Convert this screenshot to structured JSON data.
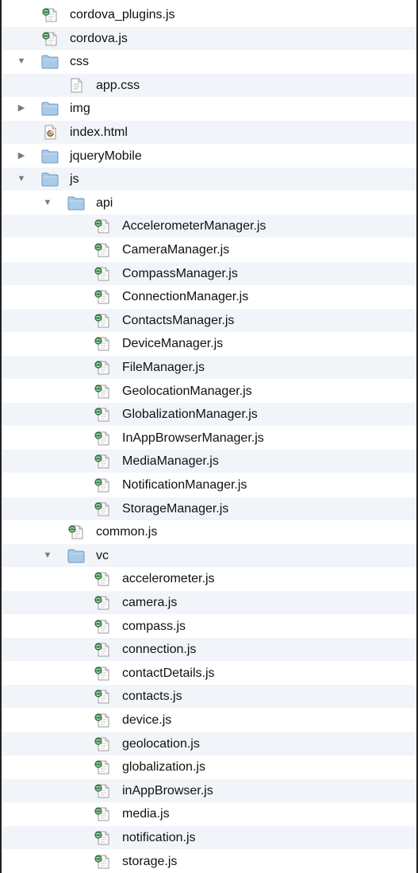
{
  "items": [
    {
      "name": "cordova_plugins.js",
      "type": "js",
      "depth": 0
    },
    {
      "name": "cordova.js",
      "type": "js",
      "depth": 0
    },
    {
      "name": "css",
      "type": "folder",
      "depth": 0,
      "expanded": true
    },
    {
      "name": "app.css",
      "type": "css",
      "depth": 1
    },
    {
      "name": "img",
      "type": "folder",
      "depth": 0,
      "expanded": false
    },
    {
      "name": "index.html",
      "type": "html",
      "depth": 0
    },
    {
      "name": "jqueryMobile",
      "type": "folder",
      "depth": 0,
      "expanded": false
    },
    {
      "name": "js",
      "type": "folder",
      "depth": 0,
      "expanded": true
    },
    {
      "name": "api",
      "type": "folder",
      "depth": 1,
      "expanded": true
    },
    {
      "name": "AccelerometerManager.js",
      "type": "js",
      "depth": 2
    },
    {
      "name": "CameraManager.js",
      "type": "js",
      "depth": 2
    },
    {
      "name": "CompassManager.js",
      "type": "js",
      "depth": 2
    },
    {
      "name": "ConnectionManager.js",
      "type": "js",
      "depth": 2
    },
    {
      "name": "ContactsManager.js",
      "type": "js",
      "depth": 2
    },
    {
      "name": "DeviceManager.js",
      "type": "js",
      "depth": 2
    },
    {
      "name": "FileManager.js",
      "type": "js",
      "depth": 2
    },
    {
      "name": "GeolocationManager.js",
      "type": "js",
      "depth": 2
    },
    {
      "name": "GlobalizationManager.js",
      "type": "js",
      "depth": 2
    },
    {
      "name": "InAppBrowserManager.js",
      "type": "js",
      "depth": 2
    },
    {
      "name": "MediaManager.js",
      "type": "js",
      "depth": 2
    },
    {
      "name": "NotificationManager.js",
      "type": "js",
      "depth": 2
    },
    {
      "name": "StorageManager.js",
      "type": "js",
      "depth": 2
    },
    {
      "name": "common.js",
      "type": "js",
      "depth": 1
    },
    {
      "name": "vc",
      "type": "folder",
      "depth": 1,
      "expanded": true
    },
    {
      "name": "accelerometer.js",
      "type": "js",
      "depth": 2
    },
    {
      "name": "camera.js",
      "type": "js",
      "depth": 2
    },
    {
      "name": "compass.js",
      "type": "js",
      "depth": 2
    },
    {
      "name": "connection.js",
      "type": "js",
      "depth": 2
    },
    {
      "name": "contactDetails.js",
      "type": "js",
      "depth": 2
    },
    {
      "name": "contacts.js",
      "type": "js",
      "depth": 2
    },
    {
      "name": "device.js",
      "type": "js",
      "depth": 2
    },
    {
      "name": "geolocation.js",
      "type": "js",
      "depth": 2
    },
    {
      "name": "globalization.js",
      "type": "js",
      "depth": 2
    },
    {
      "name": "inAppBrowser.js",
      "type": "js",
      "depth": 2
    },
    {
      "name": "media.js",
      "type": "js",
      "depth": 2
    },
    {
      "name": "notification.js",
      "type": "js",
      "depth": 2
    },
    {
      "name": "storage.js",
      "type": "js",
      "depth": 2
    }
  ],
  "icons": {
    "folder": "folder-icon",
    "js": "js-file-icon",
    "css": "css-file-icon",
    "html": "html-file-icon"
  },
  "colors": {
    "row_alt": "#f1f5fa",
    "folder": "#a9cbe8",
    "disclosure": "#777777"
  }
}
